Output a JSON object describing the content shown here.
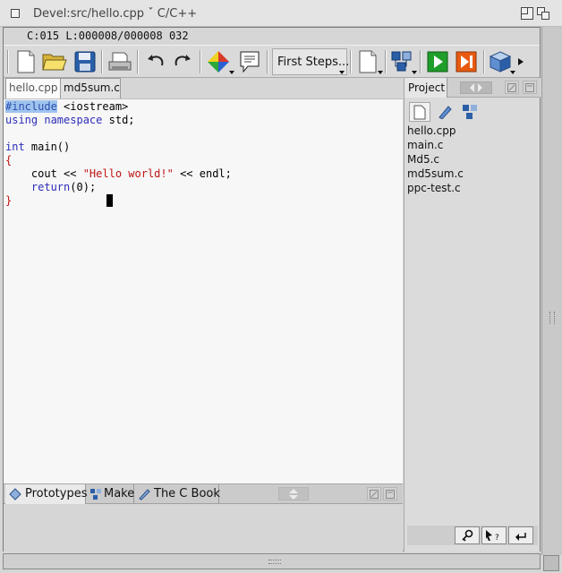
{
  "window": {
    "title": "Devel:src/hello.cpp ˇ C/C++"
  },
  "status": {
    "text": "C:015 L:000008/000008 032"
  },
  "toolbar": {
    "combo_label": "First Steps..."
  },
  "tabs": [
    {
      "label": "hello.cpp",
      "active": true
    },
    {
      "label": "md5sum.c",
      "active": false
    }
  ],
  "editor": {
    "lines": [
      [
        {
          "t": "#include",
          "c": "kw-hl"
        },
        {
          "t": " <iostream>",
          "c": ""
        }
      ],
      [
        {
          "t": "using",
          "c": "kw"
        },
        {
          "t": " ",
          "c": ""
        },
        {
          "t": "namespace",
          "c": "kw"
        },
        {
          "t": " std;",
          "c": ""
        }
      ],
      [
        {
          "t": "",
          "c": ""
        }
      ],
      [
        {
          "t": "int",
          "c": "kw"
        },
        {
          "t": " main()",
          "c": ""
        }
      ],
      [
        {
          "t": "{",
          "c": "brace"
        }
      ],
      [
        {
          "t": "    cout << ",
          "c": ""
        },
        {
          "t": "\"Hello world!\"",
          "c": "str"
        },
        {
          "t": " << endl;",
          "c": ""
        }
      ],
      [
        {
          "t": "    ",
          "c": ""
        },
        {
          "t": "return",
          "c": "kw"
        },
        {
          "t": "(0);",
          "c": ""
        }
      ],
      [
        {
          "t": "}",
          "c": "brace"
        }
      ]
    ]
  },
  "bottom_tabs": [
    {
      "label": "Prototypes",
      "icon": "prototypes-icon"
    },
    {
      "label": "Make",
      "icon": "make-icon"
    },
    {
      "label": "The C Book",
      "icon": "book-icon"
    }
  ],
  "project": {
    "title": "Project",
    "files": [
      "hello.cpp",
      "main.c",
      "Md5.c",
      "md5sum.c",
      "ppc-test.c"
    ]
  },
  "colors": {
    "keyword": "#2d2dbb",
    "string": "#c01414",
    "selection": "#9fc4ee"
  }
}
